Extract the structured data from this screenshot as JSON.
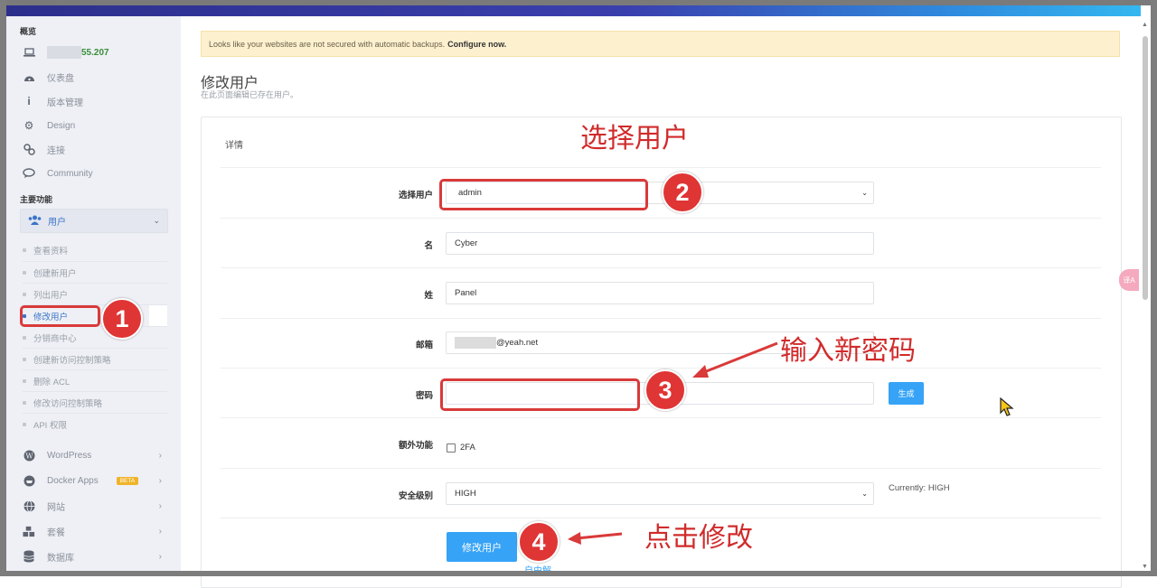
{
  "banner": {
    "text": "Looks like your websites are not secured with automatic backups.",
    "link": "Configure now."
  },
  "sidebar": {
    "overview_heading": "概览",
    "ip_suffix": "55.207",
    "items": [
      {
        "label": "仪表盘",
        "icon": "dashboard-icon"
      },
      {
        "label": "版本管理",
        "icon": "info-icon"
      },
      {
        "label": "Design",
        "icon": "gear-icon"
      },
      {
        "label": "连接",
        "icon": "link-icon"
      },
      {
        "label": "Community",
        "icon": "chat-icon"
      }
    ],
    "main_heading": "主要功能",
    "users_label": "用户",
    "sub_items": [
      "查看资料",
      "创建新用户",
      "列出用户",
      "修改用户",
      "分销商中心",
      "创建新访问控制策略",
      "删除 ACL",
      "修改访问控制策略",
      "API 权限"
    ],
    "lower_items": [
      {
        "label": "WordPress",
        "icon": "wordpress-icon"
      },
      {
        "label": "Docker Apps",
        "icon": "docker-icon",
        "badge": "BETA"
      },
      {
        "label": "网站",
        "icon": "globe-icon"
      },
      {
        "label": "套餐",
        "icon": "cubes-icon"
      },
      {
        "label": "数据库",
        "icon": "database-icon"
      }
    ]
  },
  "page": {
    "title": "修改用户",
    "subtitle": "在此页面编辑已存在用户。"
  },
  "card_title": "详情",
  "form": {
    "select_user_label": "选择用户",
    "select_user_value": "admin",
    "first_name_label": "名",
    "first_name_value": "Cyber",
    "last_name_label": "姓",
    "last_name_value": "Panel",
    "email_label": "邮箱",
    "email_suffix": "@yeah.net",
    "password_label": "密码",
    "password_value": "",
    "generate_button": "生成",
    "extra_label": "额外功能",
    "twofa_label": "2FA",
    "security_label": "安全级别",
    "security_value": "HIGH",
    "currently_text": "Currently: HIGH",
    "submit_button": "修改用户"
  },
  "footer_partial": "自由解",
  "annotations": {
    "n1": "1",
    "n2": "2",
    "n3": "3",
    "n4": "4",
    "select_user": "选择用户",
    "enter_password": "输入新密码",
    "click_modify": "点击修改",
    "color": "#d93a3a"
  },
  "translate_fab": "译A",
  "colors": {
    "accent": "#36a3f7",
    "topbar": "#2c2f8a",
    "annotation": "#d93a3a",
    "banner_bg": "#fcf0cf"
  }
}
